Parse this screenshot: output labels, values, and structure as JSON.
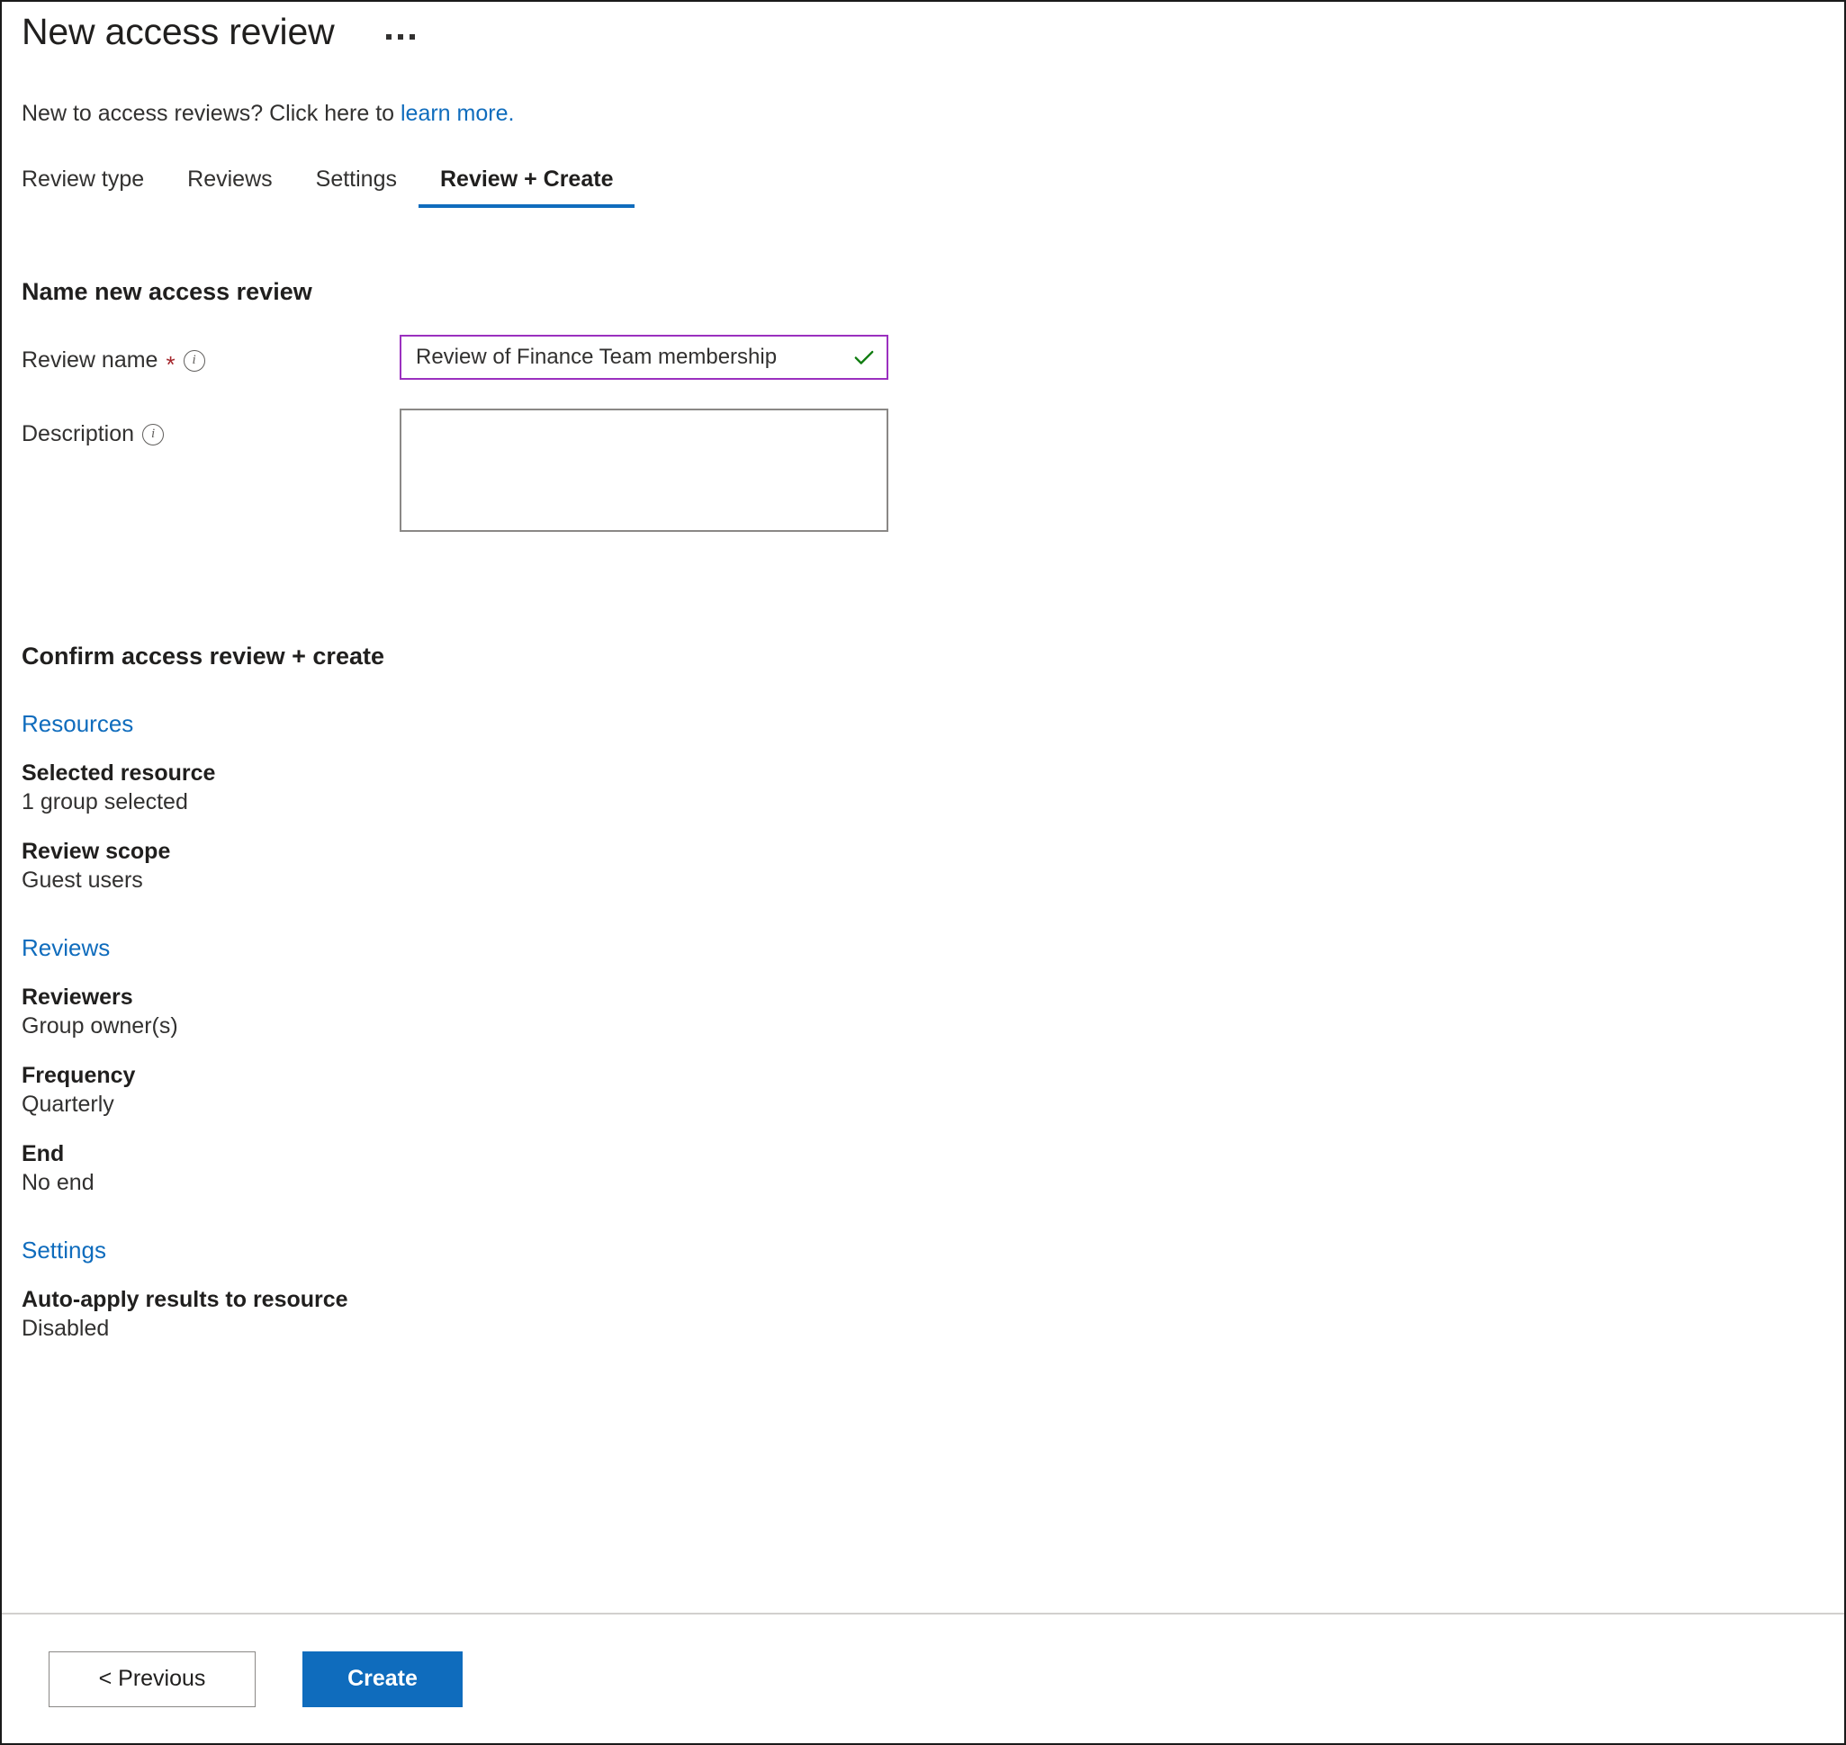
{
  "header": {
    "title": "New access review",
    "more_icon": "ellipsis-icon",
    "subtitle_prefix": "New to access reviews? Click here to ",
    "subtitle_link": "learn more."
  },
  "tabs": [
    {
      "label": "Review type",
      "active": false
    },
    {
      "label": "Reviews",
      "active": false
    },
    {
      "label": "Settings",
      "active": false
    },
    {
      "label": "Review + Create",
      "active": true
    }
  ],
  "name_section": {
    "heading": "Name new access review",
    "review_name": {
      "label": "Review name",
      "required_marker": "*",
      "info_icon": "info-icon",
      "value": "Review of Finance Team membership",
      "placeholder": "",
      "valid_icon": "checkmark-icon"
    },
    "description": {
      "label": "Description",
      "info_icon": "info-icon",
      "value": "",
      "placeholder": ""
    }
  },
  "confirm_section": {
    "heading": "Confirm access review + create",
    "groups": [
      {
        "link": "Resources",
        "rows": [
          {
            "key": "Selected resource",
            "value": "1 group selected"
          },
          {
            "key": "Review scope",
            "value": "Guest users"
          }
        ]
      },
      {
        "link": "Reviews",
        "rows": [
          {
            "key": "Reviewers",
            "value": "Group owner(s)"
          },
          {
            "key": "Frequency",
            "value": "Quarterly"
          },
          {
            "key": "End",
            "value": "No end"
          }
        ]
      },
      {
        "link": "Settings",
        "rows": [
          {
            "key": "Auto-apply results to resource",
            "value": "Disabled"
          }
        ]
      }
    ]
  },
  "footer": {
    "previous_label": "< Previous",
    "create_label": "Create"
  },
  "colors": {
    "accent_blue": "#0f6cbd",
    "link_blue": "#0f6cbd",
    "required_red": "#a4262c",
    "valid_green": "#107c10",
    "focus_purple": "#9b30bf",
    "text_primary": "#201f1e",
    "text_secondary": "#323130",
    "border_gray": "#8a8886",
    "divider_gray": "#d2d0ce"
  }
}
